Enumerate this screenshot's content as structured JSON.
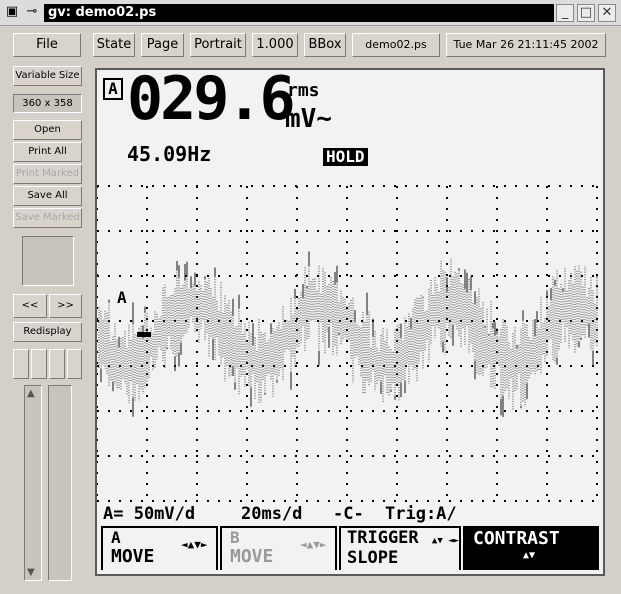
{
  "window": {
    "title": "gv: demo02.ps",
    "close_glyph": "✕",
    "maximize_glyph": "□",
    "minimize_glyph": "_"
  },
  "toolbar": {
    "file": "File",
    "state": "State",
    "page": "Page",
    "orientation": "Portrait",
    "magnification": "1.000",
    "bbox": "BBox",
    "filename": "demo02.ps",
    "date": "Tue Mar 26 21:11:45 2002"
  },
  "side": {
    "variable_size": "Variable Size",
    "size": "360 x 358",
    "open": "Open",
    "print_all": "Print All",
    "print_marked": "Print Marked",
    "save_all": "Save All",
    "save_marked": "Save Marked",
    "prev": "<<",
    "next": ">>",
    "redisplay": "Redisplay"
  },
  "scope": {
    "channel_badge": "A",
    "reading": "029.6",
    "unit_top": "rms",
    "unit_bottom": "mV~",
    "frequency": "45.09Hz",
    "hold": "HOLD",
    "marker_a": "A",
    "status": {
      "volts": "A= 50mV/d",
      "time": "20ms/d",
      "trig": "Trig:A/"
    },
    "softkeys": [
      {
        "line1": "A",
        "line2": "MOVE",
        "arrow": "◄▲▼►"
      },
      {
        "line1": "B",
        "line2": "MOVE",
        "arrow": "◄▲▼►"
      },
      {
        "line1": "TRIGGER",
        "line2": "SLOPE",
        "arrow": "▲▼ ◄►"
      },
      {
        "line1": "CONTRAST",
        "line2": "",
        "arrow": "▲▼"
      }
    ]
  },
  "colors": {
    "accent": "#000000",
    "panel": "#d4d0c8",
    "screen": "#f2f2f2"
  }
}
